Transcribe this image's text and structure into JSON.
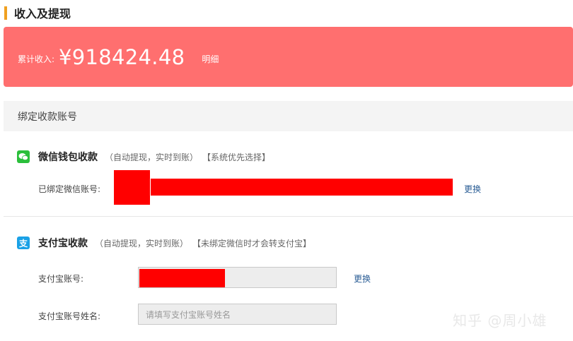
{
  "section_title": "收入及提现",
  "income": {
    "label": "累计收入:",
    "amount": "¥918424.48",
    "detail_link": "明细",
    "card_color": "#ff6f6f"
  },
  "bind_header": "绑定收款账号",
  "wechat": {
    "icon": "wechat-icon",
    "title": "微信钱包收款",
    "note": "（自动提现，实时到账）",
    "tag": "【系统优先选择】",
    "account_label": "已绑定微信账号:",
    "change_link": "更换"
  },
  "alipay": {
    "icon": "alipay-icon",
    "title": "支付宝收款",
    "note": "（自动提现，实时到账）",
    "tag": "【未绑定微信时才会转支付宝】",
    "account_label": "支付宝账号:",
    "change_link": "更换",
    "name_label": "支付宝账号姓名:",
    "name_placeholder": "请填写支付宝账号姓名"
  },
  "watermark": "知乎 @周小雄",
  "colors": {
    "accent": "#f0a020",
    "link": "#2a5d95",
    "redaction": "#ff0000"
  }
}
